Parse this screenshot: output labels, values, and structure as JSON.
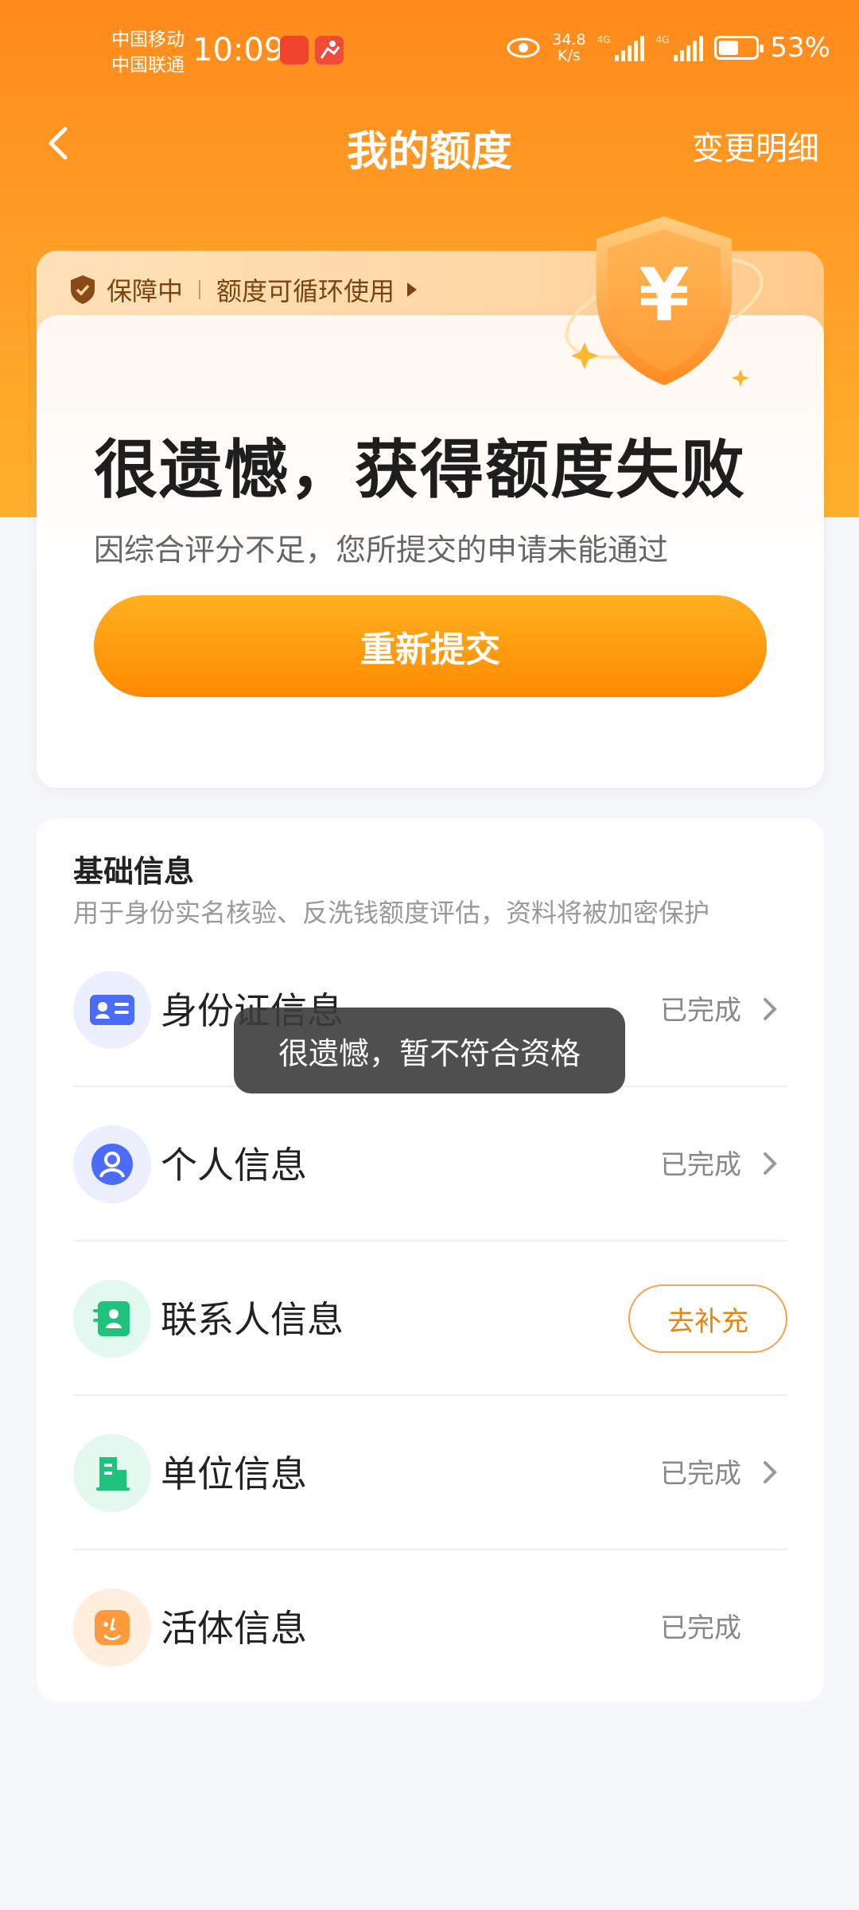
{
  "status_bar": {
    "carrier_1": "中国移动",
    "carrier_2": "中国联通",
    "time": "10:09",
    "net_speed_value": "34.8",
    "net_speed_unit": "K/s",
    "signal_1_label": "4G",
    "signal_2_label": "4G",
    "battery_level": 53,
    "battery_text": "53%"
  },
  "nav": {
    "title": "我的额度",
    "right_link": "变更明细"
  },
  "status_card": {
    "badge": "保障中",
    "tagline": "额度可循环使用",
    "heading": "很遗憾，获得额度失败",
    "subtext": "因综合评分不足，您所提交的申请未能通过",
    "button": "重新提交"
  },
  "info_section": {
    "title": "基础信息",
    "subtitle": "用于身份实名核验、反洗钱额度评估，资料将被加密保护",
    "items": [
      {
        "label": "身份证信息",
        "status": "已完成",
        "icon": "id-card-icon",
        "color": "#4a6cf7"
      },
      {
        "label": "个人信息",
        "status": "已完成",
        "icon": "person-icon",
        "color": "#4a6cf7"
      },
      {
        "label": "联系人信息",
        "action": "去补充",
        "icon": "contacts-icon",
        "color": "#1ec27a"
      },
      {
        "label": "单位信息",
        "status": "已完成",
        "icon": "building-icon",
        "color": "#1ec27a"
      },
      {
        "label": "活体信息",
        "status": "已完成",
        "icon": "face-icon",
        "color": "#ff9a3c"
      }
    ]
  },
  "toast": "很遗憾，暂不符合资格",
  "colors": {
    "brand": "#ff8a1c",
    "button": "#ff9a10",
    "supplement": "#e9860f"
  }
}
